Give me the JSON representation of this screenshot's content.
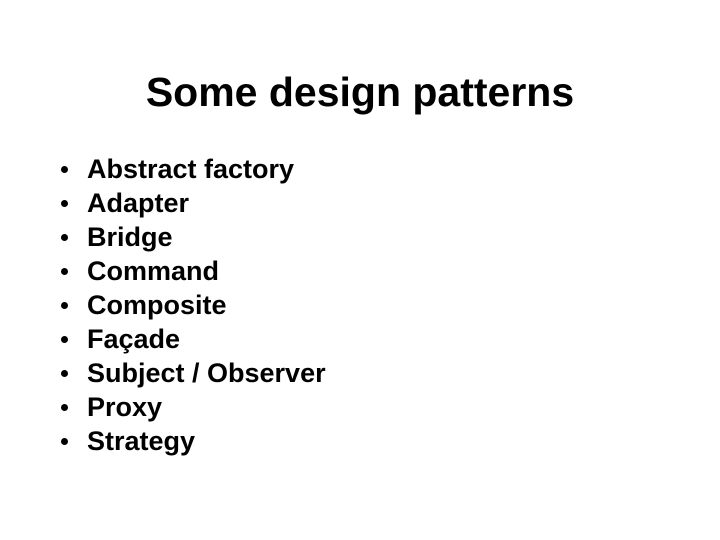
{
  "slide": {
    "title": "Some design patterns",
    "background_color": "#ffffff",
    "text_color": "#000000",
    "bullet_marker": "round-dot",
    "items": [
      {
        "label": "Abstract factory"
      },
      {
        "label": "Adapter"
      },
      {
        "label": "Bridge"
      },
      {
        "label": "Command"
      },
      {
        "label": "Composite"
      },
      {
        "label": "Façade"
      },
      {
        "label": "Subject / Observer"
      },
      {
        "label": "Proxy"
      },
      {
        "label": "Strategy"
      }
    ]
  }
}
